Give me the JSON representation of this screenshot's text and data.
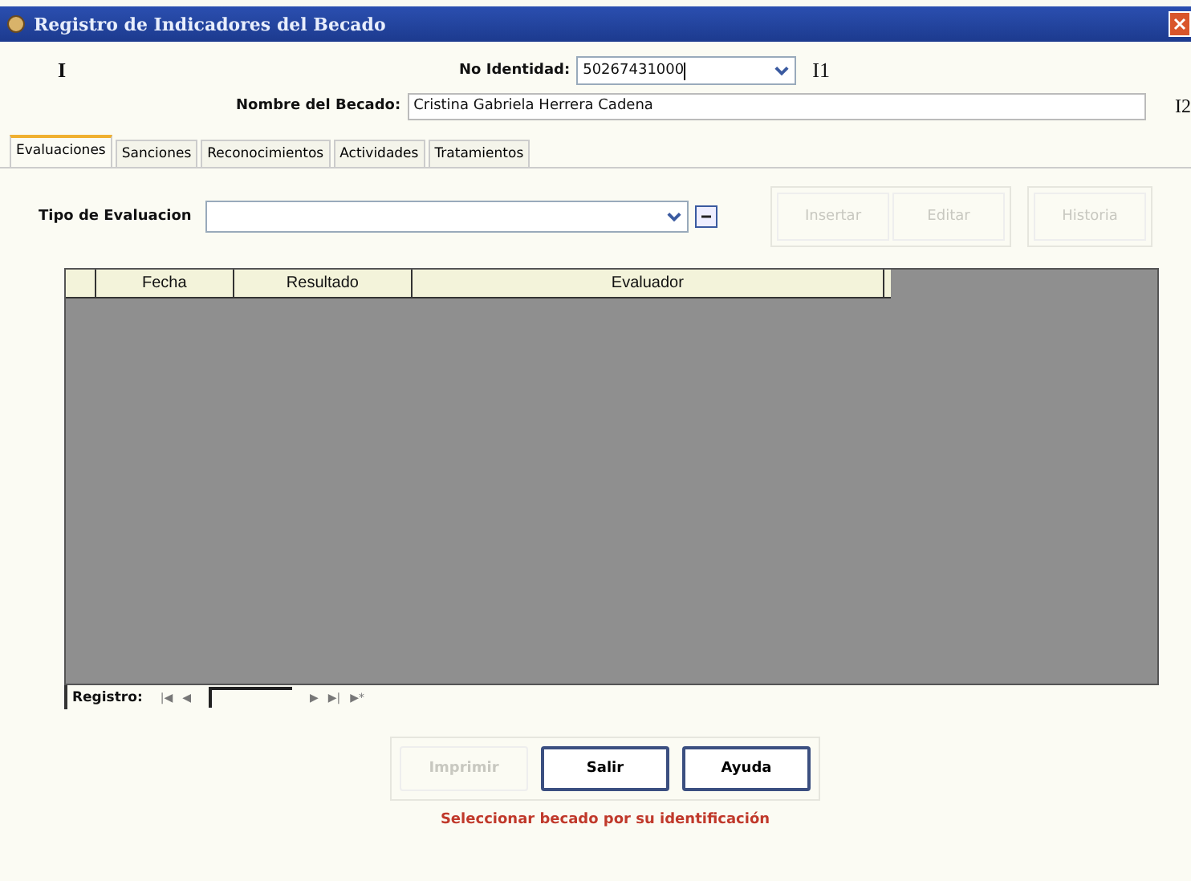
{
  "window": {
    "title": "Registro de Indicadores del Becado"
  },
  "header": {
    "marker": "I",
    "id_label": "No Identidad:",
    "id_value": "50267431000",
    "id_marker": "I1",
    "name_label": "Nombre del Becado:",
    "name_value": "Cristina Gabriela Herrera Cadena",
    "name_marker": "I2"
  },
  "tabs": [
    {
      "label": "Evaluaciones",
      "selected": true
    },
    {
      "label": "Sanciones",
      "selected": false
    },
    {
      "label": "Reconocimientos",
      "selected": false
    },
    {
      "label": "Actividades",
      "selected": false
    },
    {
      "label": "Tratamientos",
      "selected": false
    }
  ],
  "filter": {
    "label": "Tipo de Evaluacion"
  },
  "actions": [
    {
      "label": "Insertar",
      "disabled": true
    },
    {
      "label": "Editar",
      "disabled": true
    },
    {
      "label": "Historia",
      "disabled": true
    }
  ],
  "table": {
    "columns": [
      "Fecha",
      "Resultado",
      "Evaluador"
    ]
  },
  "navigator": {
    "label": "Registro:",
    "buttons": [
      "|◀",
      "◀",
      "▶",
      "▶|",
      "▶*"
    ]
  },
  "buttons": [
    {
      "label": "Imprimir",
      "disabled": true
    },
    {
      "label": "Salir",
      "disabled": false
    },
    {
      "label": "Ayuda",
      "disabled": false
    }
  ],
  "status": "Seleccionar becado por su identificación"
}
